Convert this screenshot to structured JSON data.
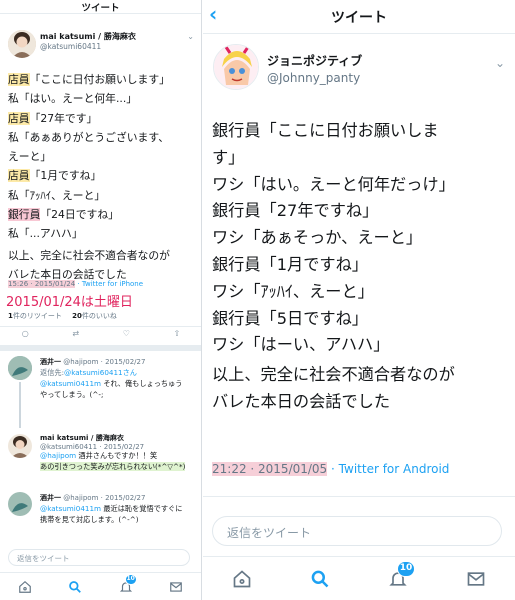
{
  "left": {
    "header_title": "ツイート",
    "tweet": {
      "user_name": "mai katsumi / 勝海麻衣",
      "user_handle": "@katsumi60411",
      "lines": [
        {
          "label": "店員",
          "text": "「ここに日付お願いします」",
          "hl": "y"
        },
        {
          "label": "私",
          "text": "「はい。えーと何年...」",
          "hl": ""
        },
        {
          "label": "店員",
          "text": "「27年です」",
          "hl": "y"
        },
        {
          "label": "私",
          "text": "「あぁありがとうございます、",
          "hl": ""
        },
        {
          "label": "",
          "text": "えーと」",
          "hl": ""
        },
        {
          "label": "店員",
          "text": "「1月ですね」",
          "hl": "y"
        },
        {
          "label": "私",
          "text": "「ｱｯﾊｲ、えーと」",
          "hl": ""
        },
        {
          "label": "銀行員",
          "text": "「24日ですね」",
          "hl": "p"
        },
        {
          "label": "私",
          "text": "「...アハハ」",
          "hl": ""
        },
        {
          "label": "",
          "text": "以上、完全に社会不適合者なのが",
          "hl": ""
        },
        {
          "label": "",
          "text": "バレた本日の会話でした",
          "hl": ""
        }
      ],
      "time": "15:26 · 2015/01/24",
      "source": "· Twitter for iPhone",
      "annotation": "2015/01/24は土曜日",
      "retweet_count": "1",
      "retweet_label": "件のリツイート",
      "like_count": "20",
      "like_label": "件のいいね"
    },
    "replies": [
      {
        "name": "酒井一",
        "meta": "@hajipom · 2015/02/27",
        "reply_to_label": "返信先:",
        "reply_to_handle": "@katsumi60411さん",
        "mention": "@katsumi0411m",
        "text1": "それ、俺もしょっちゅう",
        "text2": "やってしまう。(^-;"
      },
      {
        "name": "mai katsumi / 勝海麻衣",
        "meta": "@katsumi60411 · 2015/02/27",
        "mention": "@hajipom",
        "text1": "酒井さんもですか！！笑",
        "text2": "あの引きつった笑みが忘れられない(*^▽^*)"
      },
      {
        "name": "酒井一",
        "meta": "@hajipom · 2015/02/27",
        "mention": "@katsumi0411m",
        "text1": "最近は恥を覚悟ですぐに",
        "text2": "携帯を見て対応します。(^-^)"
      }
    ],
    "reply_placeholder": "返信をツイート",
    "notification_count": "10"
  },
  "right": {
    "header_title": "ツイート",
    "tweet": {
      "user_name": "ジョニポジティブ",
      "user_handle": "@Johnny_panty",
      "lines": [
        "銀行員「ここに日付お願いしま",
        "す」",
        "ワシ「はい。えーと何年だっけ」",
        "銀行員「27年ですね」",
        "ワシ「あぁそっか、えーと」",
        "銀行員「1月ですね」",
        "ワシ「ｱｯﾊｲ、えーと」",
        "銀行員「5日ですね」",
        "ワシ「はーい、アハハ」",
        "以上、完全に社会不適合者なのが",
        "バレた本日の会話でした"
      ],
      "time": "21:22 · 2015/01/05",
      "source": "· Twitter for Android"
    },
    "reply_placeholder": "返信をツイート",
    "notification_count": "10"
  },
  "icons": [
    "back-icon",
    "chevron-down-icon",
    "home-icon",
    "search-icon",
    "bell-icon",
    "mail-icon"
  ],
  "colors": {
    "accent": "#1da1f2",
    "highlight_yellow": "#fdeaa8",
    "highlight_pink": "#f8c8d4",
    "annotation_red": "#e0245e"
  }
}
